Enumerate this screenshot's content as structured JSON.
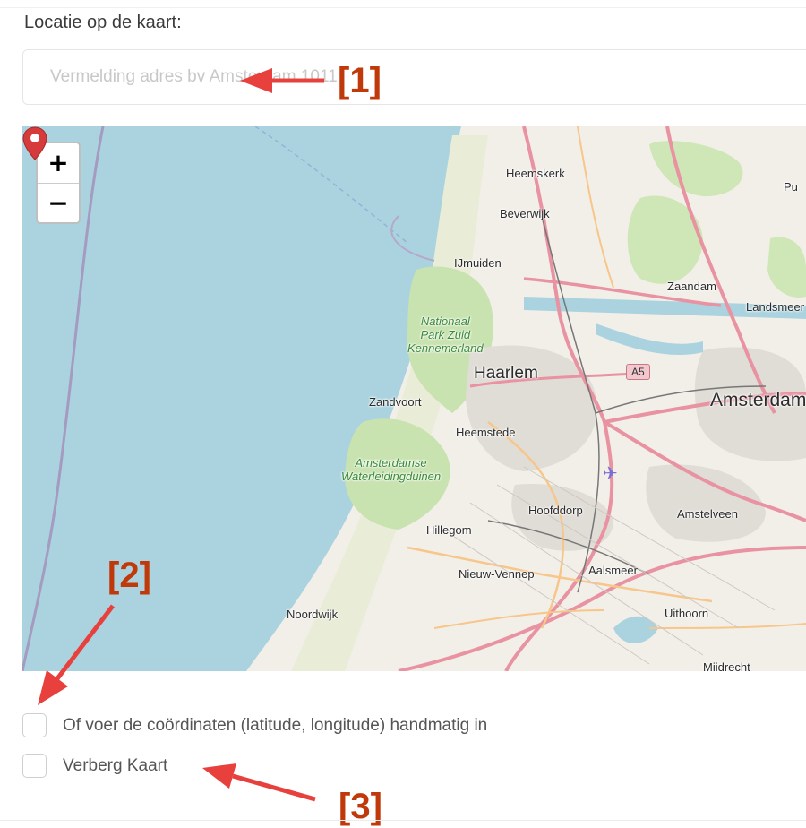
{
  "section": {
    "title": "Locatie op de kaart:"
  },
  "address": {
    "placeholder": "Vermelding adres bv Amsterdam 1011",
    "value": ""
  },
  "map": {
    "zoom_in_label": "+",
    "zoom_out_label": "−",
    "labels": {
      "heemskerk": "Heemskerk",
      "beverwijk": "Beverwijk",
      "ijmuiden": "IJmuiden",
      "zaandam": "Zaandam",
      "landsmeer": "Landsmeer",
      "park_zuid_1": "Nationaal",
      "park_zuid_2": "Park Zuid",
      "park_zuid_3": "Kennemerland",
      "haarlem": "Haarlem",
      "a5": "A5",
      "amsterdam": "Amsterdam",
      "zandvoort": "Zandvoort",
      "heemstede": "Heemstede",
      "awd_1": "Amsterdamse",
      "awd_2": "Waterleidingduinen",
      "hoofddorp": "Hoofddorp",
      "amstelveen": "Amstelveen",
      "hillegom": "Hillegom",
      "nieuw_vennep": "Nieuw-Vennep",
      "aalsmeer": "Aalsmeer",
      "noordwijk": "Noordwijk",
      "uithoorn": "Uithoorn",
      "mijdrecht": "Mijdrecht",
      "purmerend": "Pu"
    }
  },
  "options": {
    "manual_coords_label": "Of voer de coördinaten (latitude, longitude) handmatig in",
    "hide_map_label": "Verberg Kaart"
  },
  "annotations": {
    "one": "[1]",
    "two": "[2]",
    "three": "[3]"
  },
  "colors": {
    "annotation": "#c0390a",
    "sea": "#aad3df",
    "land": "#f2efe9",
    "motorway": "#e892a2",
    "marker": "#d63a3a"
  }
}
